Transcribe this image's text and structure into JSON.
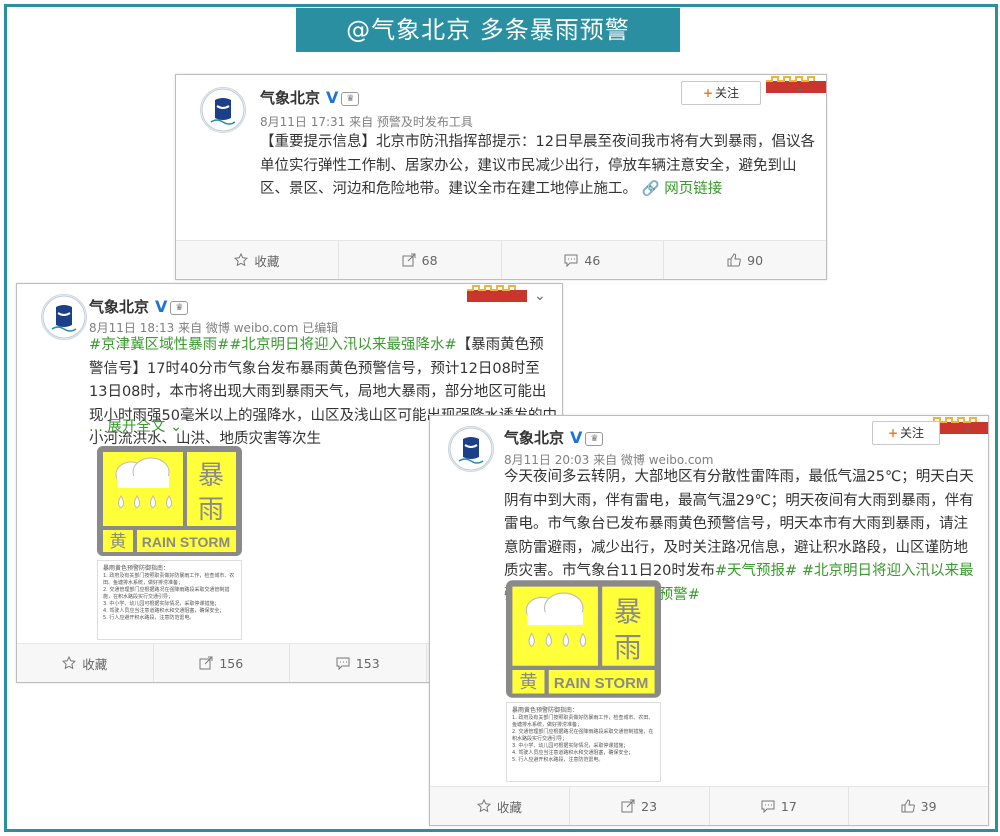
{
  "banner": {
    "title": "@气象北京  多条暴雨预警"
  },
  "colors": {
    "accent": "#2a8fa0",
    "topic_green": "#3a9a2e",
    "alert_yellow": "#ffff3a",
    "verified_blue": "#1e73d8"
  },
  "icons": {
    "favorite": "star-icon",
    "repost": "repost-icon",
    "comment": "comment-icon",
    "like": "thumbs-up-icon",
    "verified": "verified-v-icon",
    "member": "crown-icon",
    "more": "chevron-down-icon",
    "follow": "plus-icon"
  },
  "posts": [
    {
      "user": "气象北京",
      "verified": "V",
      "follow": "关注",
      "meta": "8月11日 17:31 来自 预警及时发布工具",
      "text": "【重要提示信息】北京市防汛指挥部提示：12日早晨至夜间我市将有大到暴雨，倡议各单位实行弹性工作制、居家办公，建议市民减少出行，停放车辆注意安全，避免到山区、景区、河边和危险地带。建议全市在建工地停止施工。",
      "link": "网页链接",
      "actions": {
        "favorite": "收藏",
        "repost": "68",
        "comment": "46",
        "like": "90"
      }
    },
    {
      "user": "气象北京",
      "verified": "V",
      "meta": "8月11日 18:13 来自 微博 weibo.com  已编辑",
      "tag1": "#京津冀区域性暴雨#",
      "tag2": "#北京明日将迎入汛以来最强降水#",
      "text": "【暴雨黄色预警信号】17时40分市气象台发布暴雨黄色预警信号，预计12日08时至13日08时，本市将出现大雨到暴雨天气，局地大暴雨，部分地区可能出现小时雨强50毫米以上的强降水，山区及浅山区可能出现强降水诱发的中小河流洪水、山洪、地质灾害等次生",
      "expand": "... 展开全文",
      "actions": {
        "favorite": "收藏",
        "repost": "156",
        "comment": "153"
      }
    },
    {
      "user": "气象北京",
      "verified": "V",
      "follow": "关注",
      "meta": "8月11日 20:03 来自 微博 weibo.com",
      "text": "今天夜间多云转阴，大部地区有分散性雷阵雨，最低气温25℃；明天白天阴有中到大雨，伴有雷电，最高气温29℃；明天夜间有大雨到暴雨，伴有雷电。市气象台已发布暴雨黄色预警信号，明天本市有大雨到暴雨，请注意防雷避雨，减少出行，及时关注路况信息，避让积水路段，山区谨防地质灾害。市气象台11日20时发布",
      "tags": [
        "#天气预报#",
        "#北京明日将迎入汛以来最强降水#",
        "#北京发布暴雨预警#"
      ],
      "actions": {
        "favorite": "收藏",
        "repost": "23",
        "comment": "17",
        "like": "39"
      }
    }
  ],
  "alert_icon": {
    "big1": "暴",
    "big2": "雨",
    "color_char": "黄",
    "en": "RAIN STORM"
  },
  "notice": {
    "title": "暴雨黄色预警防御指南：",
    "lines": [
      "1. 政府及有关部门按照职责做好防暴雨工作，检查城市、农田、鱼塘排水系统，做好排涝准备；",
      "2. 交通管理部门应根据路况在强降雨路段采取交通管制措施，在积水路段实行交通引导；",
      "3. 中小学、幼儿园可根据实际情况，采取停课措施；",
      "4. 驾驶人员应当注意道路积水和交通阻塞，确保安全；",
      "5. 行人应避开积水路段，注意防范雷电。"
    ]
  }
}
